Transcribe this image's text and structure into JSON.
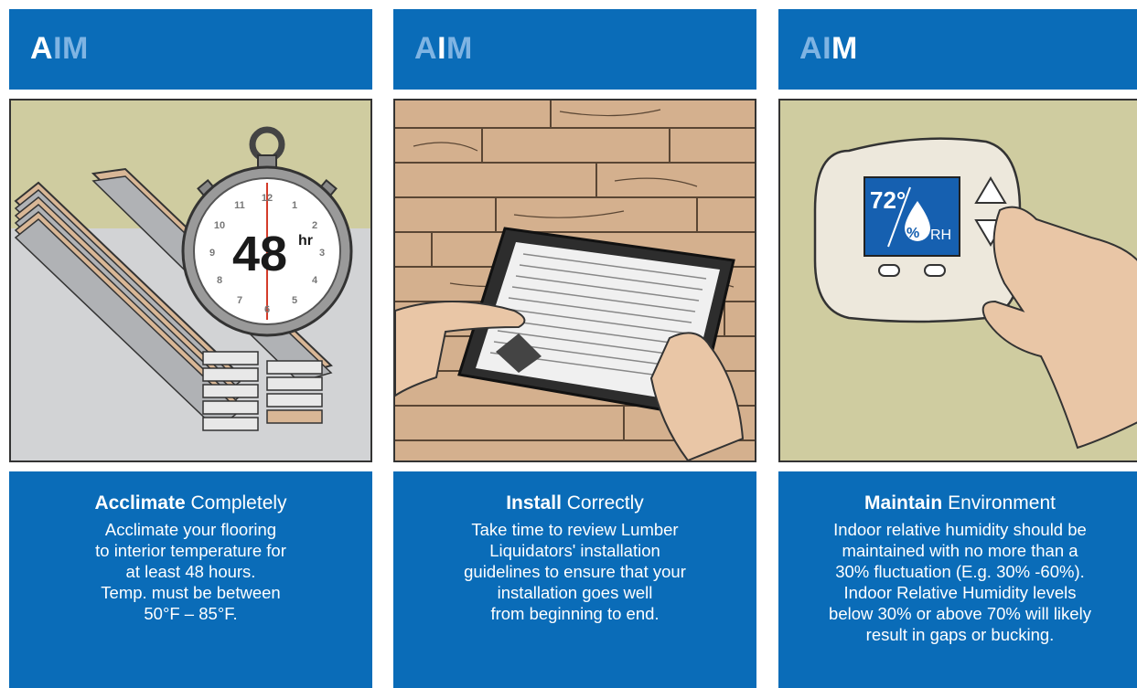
{
  "panels": [
    {
      "header": {
        "letters": [
          "A",
          "I",
          "M"
        ],
        "highlight": "A"
      },
      "title_bold": "Acclimate",
      "title_rest": "Completely",
      "body_lines": [
        "Acclimate your flooring",
        "to interior temperature for",
        "at least 48 hours.",
        "Temp. must be between",
        "50°F – 85°F."
      ],
      "illustration": {
        "description_icon": "stopwatch-icon",
        "stopwatch_number": "48",
        "stopwatch_unit": "hr",
        "dial_numbers": [
          "12",
          "1",
          "2",
          "3",
          "4",
          "5",
          "6",
          "7",
          "8",
          "9",
          "10",
          "11"
        ]
      }
    },
    {
      "header": {
        "letters": [
          "A",
          "I",
          "M"
        ],
        "highlight": "I"
      },
      "title_bold": "Install",
      "title_rest": "Correctly",
      "body_lines": [
        "Take time to review Lumber",
        "Liquidators' installation",
        "guidelines to ensure that your",
        "installation goes well",
        "from beginning to end."
      ],
      "illustration": {
        "description_icon": "tablet-icon"
      }
    },
    {
      "header": {
        "letters": [
          "A",
          "I",
          "M"
        ],
        "highlight": "M"
      },
      "title_bold": "Maintain",
      "title_rest": "Environment",
      "body_lines": [
        "Indoor relative humidity should be",
        "maintained with no more than a",
        "30% fluctuation (E.g. 30% -60%).",
        "Indoor Relative Humidity levels",
        "below 30% or above 70% will likely",
        "result in gaps or bucking."
      ],
      "illustration": {
        "description_icon": "thermostat-icon",
        "temp": "72°",
        "humidity_symbol": "%",
        "humidity_unit": "RH"
      }
    }
  ],
  "colors": {
    "brand_blue": "#0a6cb8",
    "letter_dim": "#7fb4e3",
    "letter_on": "#ffffff"
  }
}
